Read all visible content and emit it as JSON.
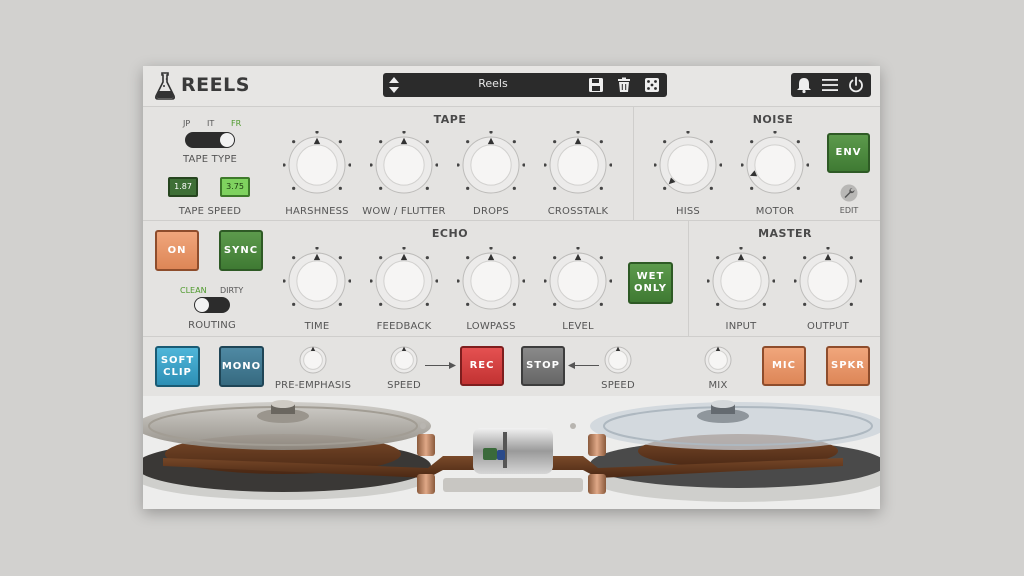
{
  "app": {
    "name": "REELS"
  },
  "preset": {
    "name": "Reels"
  },
  "icons": {
    "logo": "flask-icon",
    "preset_nav": "up-down-arrows-icon",
    "save": "save-icon",
    "delete": "trash-icon",
    "random": "dice-icon",
    "notifications": "bell-icon",
    "menu": "menu-icon",
    "power": "power-icon",
    "edit": "wrench-icon"
  },
  "tape_type": {
    "options": [
      "JP",
      "IT",
      "FR"
    ],
    "selected": "FR",
    "label": "TAPE TYPE"
  },
  "tape_speed": {
    "options": [
      "1.87",
      "3.75"
    ],
    "selected": "3.75",
    "label": "TAPE SPEED"
  },
  "tape": {
    "title": "TAPE",
    "knobs": [
      {
        "label": "HARSHNESS",
        "value": 0.5
      },
      {
        "label": "WOW / FLUTTER",
        "value": 0.5
      },
      {
        "label": "DROPS",
        "value": 0.5
      },
      {
        "label": "CROSSTALK",
        "value": 0.5
      }
    ]
  },
  "noise": {
    "title": "NOISE",
    "knobs": [
      {
        "label": "HISS",
        "value": 0.0
      },
      {
        "label": "MOTOR",
        "value": 0.08
      }
    ],
    "env_label": "ENV",
    "edit_label": "EDIT"
  },
  "echo": {
    "title": "ECHO",
    "on_label": "ON",
    "sync_label": "SYNC",
    "wet_only_line1": "WET",
    "wet_only_line2": "ONLY",
    "knobs": [
      {
        "label": "TIME",
        "value": 0.5
      },
      {
        "label": "FEEDBACK",
        "value": 0.5
      },
      {
        "label": "LOWPASS",
        "value": 0.5
      },
      {
        "label": "LEVEL",
        "value": 0.5
      }
    ]
  },
  "routing": {
    "options": [
      "CLEAN",
      "DIRTY"
    ],
    "selected": "CLEAN",
    "label": "ROUTING"
  },
  "master": {
    "title": "MASTER",
    "knobs": [
      {
        "label": "INPUT",
        "value": 0.5
      },
      {
        "label": "OUTPUT",
        "value": 0.5
      }
    ]
  },
  "bottom": {
    "soft_clip_line1": "SOFT",
    "soft_clip_line2": "CLIP",
    "mono": "MONO",
    "pre_emphasis": "PRE-EMPHASIS",
    "rec_speed": "SPEED",
    "rec": "REC",
    "stop": "STOP",
    "stop_speed": "SPEED",
    "mix": "MIX",
    "mic": "MIC",
    "spkr": "SPKR"
  },
  "colors": {
    "panel": "#e4e3e1",
    "green": "#4e9a2c",
    "orange": "#e8956a",
    "red": "#d64040",
    "blue": "#3aa4cc"
  }
}
